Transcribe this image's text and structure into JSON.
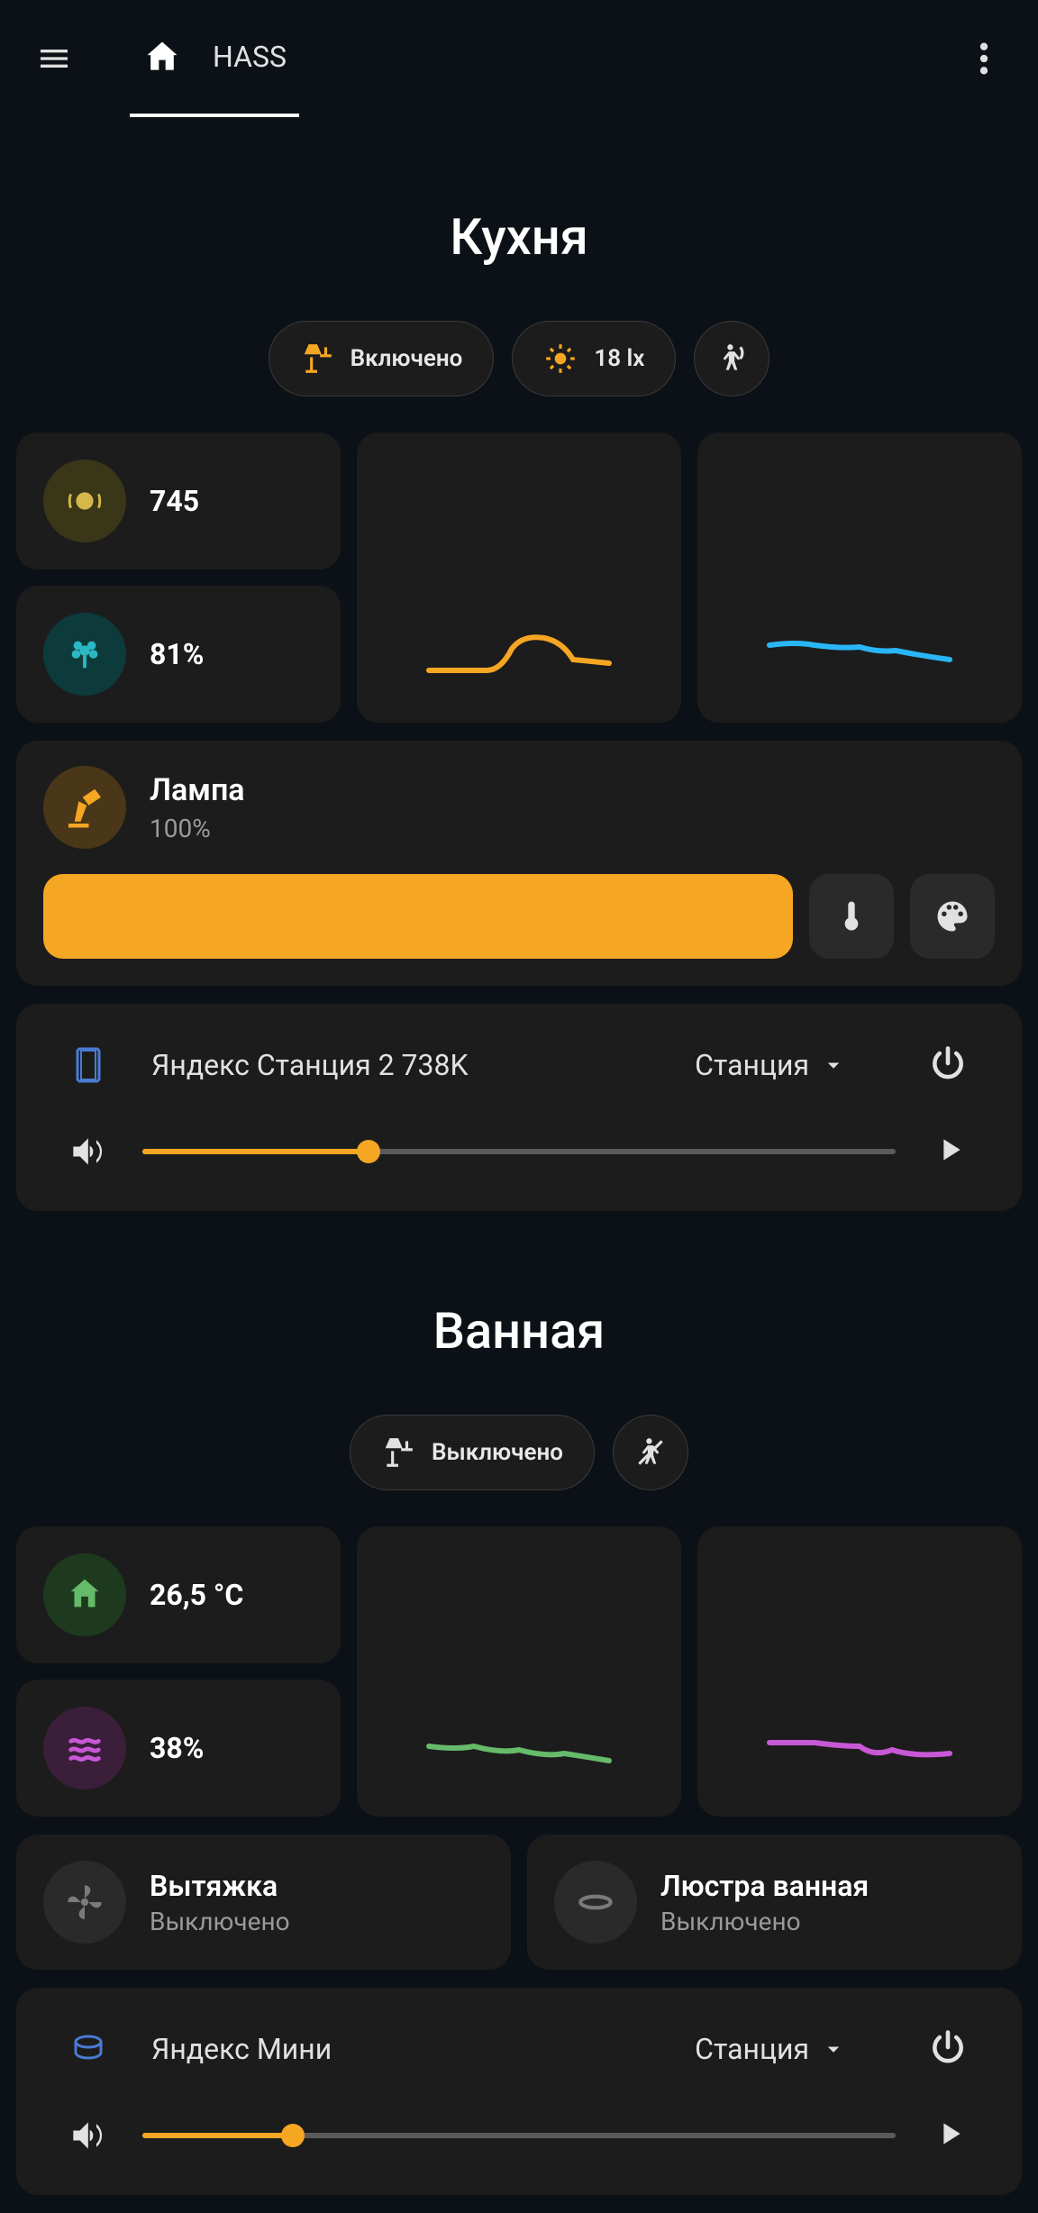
{
  "header": {
    "tab_label": "HASS"
  },
  "kitchen": {
    "title": "Кухня",
    "chip_light": "Включено",
    "chip_lux": "18 lx",
    "co2_value": "745",
    "humidity_value": "81%",
    "lamp": {
      "name": "Лампа",
      "level": "100%"
    },
    "media": {
      "name": "Яндекс Станция 2 738K",
      "source": "Станция",
      "volume_pct": 30
    }
  },
  "bathroom": {
    "title": "Ванная",
    "chip_light": "Выключено",
    "temp_value": "26,5 °C",
    "humidity_value": "38%",
    "fan": {
      "name": "Вытяжка",
      "state": "Выключено"
    },
    "ceiling": {
      "name": "Люстра ванная",
      "state": "Выключено"
    },
    "media": {
      "name": "Яндекс Мини",
      "source": "Станция",
      "volume_pct": 20
    }
  },
  "colors": {
    "orange": "#f5a623",
    "cyan": "#29b6f6",
    "green": "#66bb6a",
    "magenta": "#c858d6"
  },
  "chart_data": [
    {
      "type": "line",
      "series_name": "kitchen-co2-history",
      "x": [
        0,
        1,
        2,
        3,
        4,
        5,
        6,
        7,
        8,
        9
      ],
      "values": [
        4,
        4,
        4,
        7,
        12,
        13,
        13,
        12,
        10,
        9
      ],
      "color": "#f5a623"
    },
    {
      "type": "line",
      "series_name": "kitchen-humidity-history",
      "x": [
        0,
        1,
        2,
        3,
        4,
        5,
        6,
        7,
        8,
        9
      ],
      "values": [
        12,
        13,
        12,
        12,
        11,
        12,
        11,
        10,
        10,
        9
      ],
      "color": "#29b6f6"
    },
    {
      "type": "line",
      "series_name": "bathroom-temp-history",
      "x": [
        0,
        1,
        2,
        3,
        4,
        5,
        6,
        7,
        8,
        9
      ],
      "values": [
        11,
        11,
        10,
        11,
        10,
        9,
        10,
        9,
        9,
        8
      ],
      "color": "#66bb6a"
    },
    {
      "type": "line",
      "series_name": "bathroom-humidity-history",
      "x": [
        0,
        1,
        2,
        3,
        4,
        5,
        6,
        7,
        8,
        9
      ],
      "values": [
        12,
        12,
        12,
        11,
        11,
        9,
        10,
        9,
        9,
        9
      ],
      "color": "#c858d6"
    }
  ]
}
